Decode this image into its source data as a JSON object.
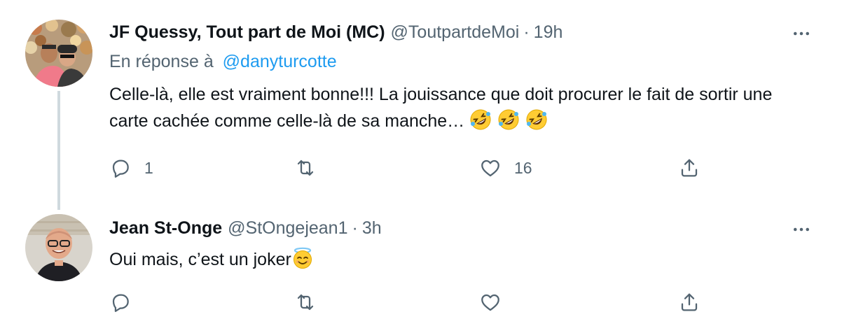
{
  "tweets": [
    {
      "display_name": "JF Quessy, Tout part de Moi (MC)",
      "handle": "@ToutpartdeMoi",
      "separator": "·",
      "time": "19h",
      "reply_prefix": "En réponse à",
      "reply_to": "@danyturcotte",
      "text": "Celle-là, elle est vraiment bonne!!! La jouissance que doit procurer le fait de sortir une carte cachée comme celle-là de sa manche… ",
      "emojis": [
        "rolling-on-floor-laughing-emoji",
        "rolling-on-floor-laughing-emoji",
        "rolling-on-floor-laughing-emoji"
      ],
      "reply_count": "1",
      "retweet_count": "",
      "like_count": "16"
    },
    {
      "display_name": "Jean St-Onge",
      "handle": "@StOngejean1",
      "separator": "·",
      "time": "3h",
      "text": "Oui mais, c’est un joker",
      "emojis": [
        "smiling-face-with-halo-emoji"
      ],
      "reply_count": "",
      "retweet_count": "",
      "like_count": ""
    }
  ],
  "colors": {
    "text": "#0f1419",
    "secondary": "#536471",
    "link": "#1d9bf0",
    "thread_line": "#cfd9de"
  },
  "icons": [
    "more-icon",
    "reply-icon",
    "retweet-icon",
    "like-icon",
    "share-icon"
  ]
}
